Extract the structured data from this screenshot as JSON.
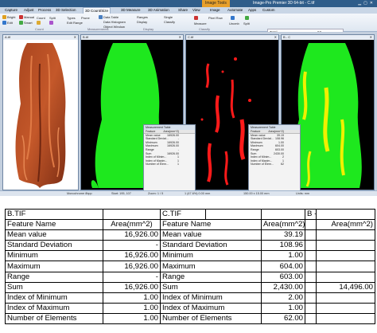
{
  "app": {
    "context_tab": "Image Tools",
    "title": "Image-Pro Premier 3D 64-bit - C.tif",
    "ribbon_tabs": [
      "Capture",
      "Adjust",
      "Process",
      "3D Selection",
      "3D Count/Size",
      "3D Measure",
      "3D Animation",
      "Share",
      "View",
      "Image",
      "Automate",
      "Apps",
      "Custom"
    ],
    "active_tab": "3D Count/Size",
    "ribbon_buttons": {
      "bright": "Bright",
      "manual": "Manual",
      "edit": "Edit",
      "smart": "Smart",
      "count": "Count",
      "split": "Split",
      "types": "Types",
      "edit_range": "Edit Range",
      "prune": "Prune",
      "data_table": "Data Table",
      "data_histogram": "Data Histogram",
      "object_window": "Object Window",
      "ranges": "Ranges",
      "display": "Display",
      "single": "Single",
      "classify": "Classify",
      "measure": "Measure",
      "pixel_row": "Pixel Row",
      "uncmb": "Uncmb",
      "split_r": "Split"
    },
    "ribbon_groups": [
      "Count",
      "Measurements",
      "Display",
      "Classify"
    ],
    "stats": {
      "total_label": "Total",
      "total_value": "62",
      "in_range_label": "In Range",
      "in_range_value": "62"
    },
    "windows": [
      {
        "title": "A.tif"
      },
      {
        "title": "B.tif"
      },
      {
        "title": "C.tif"
      },
      {
        "title": "B - C"
      }
    ],
    "measurement_table": {
      "title": "Measurement Table",
      "col_feature": "Feature",
      "col_value": "Area(mm^2)",
      "rows_b": [
        [
          "Mean value",
          "16926.00"
        ],
        [
          "Standard Deviat...",
          "-"
        ],
        [
          "Minimum",
          "16926.00"
        ],
        [
          "Maximum",
          "16926.00"
        ],
        [
          "Range",
          "-"
        ],
        [
          "Sum",
          "16926.00"
        ],
        [
          "Index of Minim...",
          "1"
        ],
        [
          "Index of Maxim...",
          "1"
        ],
        [
          "Number of Elem...",
          "1"
        ]
      ],
      "rows_c": [
        [
          "Mean value",
          "39.19"
        ],
        [
          "Standard Deviat...",
          "108.96"
        ],
        [
          "Minimum",
          "1.00"
        ],
        [
          "Maximum",
          "604.00"
        ],
        [
          "Range",
          "603.00"
        ],
        [
          "Sum",
          "2430.00"
        ],
        [
          "Index of Minim...",
          "2"
        ],
        [
          "Index of Maxim...",
          "1"
        ],
        [
          "Number of Elem...",
          "62"
        ]
      ]
    },
    "statusbar": [
      "Monochrome 8bpp",
      "Start: 195, 107",
      "Zoom: 1 / 5",
      "1 (47.6%) 0.00 mm",
      "150.00 x 15.00 mm",
      "Units: mm"
    ]
  },
  "table": {
    "rows": [
      [
        "B.TIF",
        "",
        "C.TIF",
        "",
        "",
        "B - C",
        ""
      ],
      [
        "Feature Name",
        "Area(mm^2)",
        "Feature Name",
        "",
        "Area(mm^2)",
        "",
        "Area(mm^2)"
      ],
      [
        "Mean value",
        "16,926.00",
        "Mean value",
        "",
        "39.19",
        "",
        ""
      ],
      [
        "Standard Deviation",
        "-",
        "Standard Deviation",
        "",
        "108.96",
        "",
        ""
      ],
      [
        "Minimum",
        "16,926.00",
        "Minimum",
        "",
        "1.00",
        "",
        ""
      ],
      [
        "Maximum",
        "16,926.00",
        "Maximum",
        "",
        "604.00",
        "",
        ""
      ],
      [
        "Range",
        "-",
        "Range",
        "",
        "603.00",
        "",
        ""
      ],
      [
        "Sum",
        "16,926.00",
        "Sum",
        "",
        "2,430.00",
        "",
        "14,496.00"
      ],
      [
        "Index of Minimum",
        "1.00",
        "Index of Minimum",
        "",
        "2.00",
        "",
        ""
      ],
      [
        "Index of Maximum",
        "1.00",
        "Index of Maximum",
        "",
        "1.00",
        "",
        ""
      ],
      [
        "Number of Elements",
        "1.00",
        "Number of Elements",
        "",
        "62.00",
        "",
        ""
      ]
    ]
  }
}
